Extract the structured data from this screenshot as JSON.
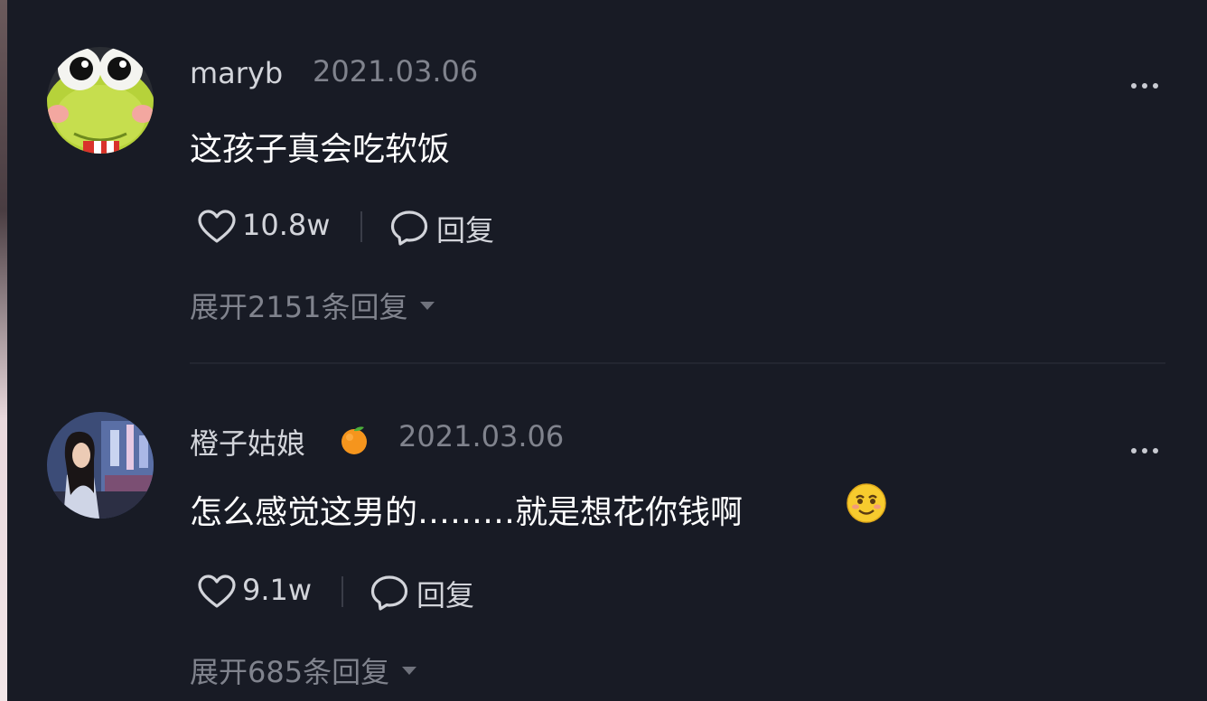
{
  "comments": [
    {
      "username": "maryb",
      "date": "2021.03.06",
      "text": "这孩子真会吃软饭",
      "likes": "10.8w",
      "reply_label": "回复",
      "expand_label": "展开2151条回复",
      "avatar_icon": "frog-avatar"
    },
    {
      "username": "橙子姑娘",
      "user_badge_icon": "orange-icon",
      "date": "2021.03.06",
      "text": "怎么感觉这男的………就是想花你钱啊",
      "trailing_emoji_icon": "smiling-face-icon",
      "likes": "9.1w",
      "reply_label": "回复",
      "expand_label": "展开685条回复",
      "avatar_icon": "girl-photo-avatar"
    }
  ],
  "colors": {
    "background": "#181b25",
    "primary_text": "#ffffff",
    "secondary_text": "#80838d",
    "username_text": "#d2d4da"
  }
}
